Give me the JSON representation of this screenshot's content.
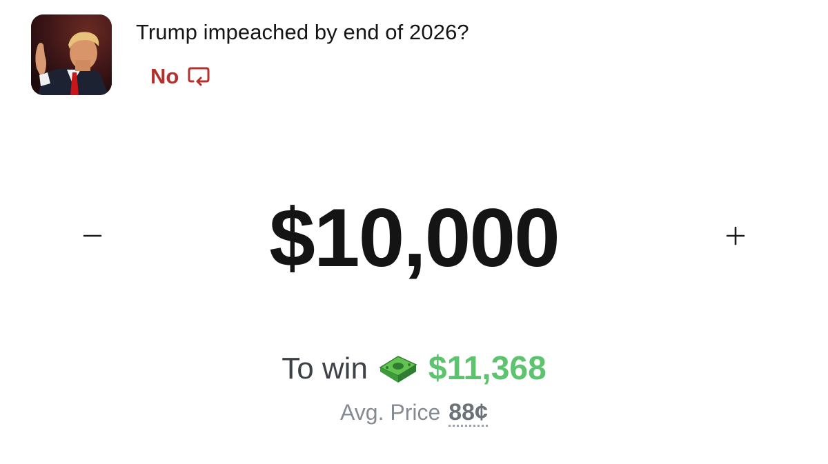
{
  "market": {
    "title": "Trump impeached by end of 2026?",
    "outcome": "No",
    "outcome_color": "#b4302c",
    "thumbnail_icon": "market-photo",
    "switch_icon": "switch-outcome-icon"
  },
  "order": {
    "amount": "$10,000",
    "decrement_icon": "minus-icon",
    "increment_icon": "plus-icon"
  },
  "payout": {
    "to_win_label": "To win",
    "money_icon": "dollar-banknote-icon",
    "to_win_value": "$11,368",
    "to_win_color": "#5cc46f",
    "avg_price_label": "Avg. Price",
    "avg_price_value": "88¢"
  }
}
